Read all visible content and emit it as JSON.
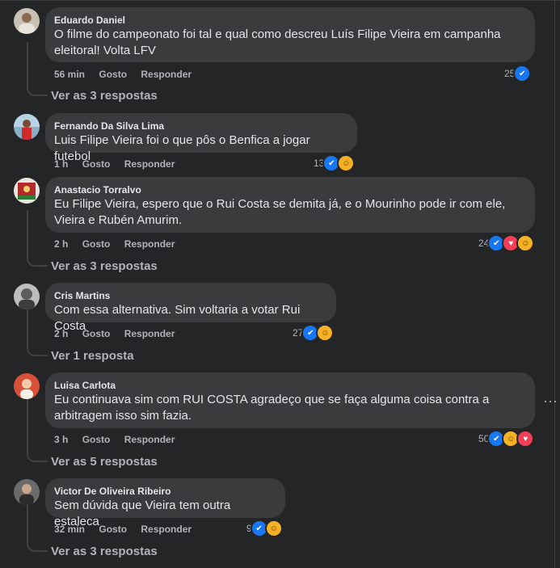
{
  "comments": [
    {
      "author": "Eduardo Daniel",
      "text_lines": [
        "O filme do campeonato foi tal e qual como descreu Luís Filipe Vieira em campanha",
        "eleitoral! Volta LFV"
      ],
      "time": "56 min",
      "like_label": "Gosto",
      "reply_label": "Responder",
      "reaction_count": "25",
      "reactions": [
        "like"
      ],
      "replies_link": "Ver as 3 respostas"
    },
    {
      "author": "Fernando Da Silva Lima",
      "text_lines": [
        "Luis Filipe Vieira foi o que pôs o Benfica a jogar futebol"
      ],
      "time": "1 h",
      "like_label": "Gosto",
      "reply_label": "Responder",
      "reaction_count": "13",
      "reactions": [
        "like",
        "haha"
      ],
      "replies_link": ""
    },
    {
      "author": "Anastacio Torralvo",
      "text_lines": [
        "Eu Filipe Vieira, espero que o Rui Costa se demita já, e o Mourinho pode ir com ele,",
        "Vieira e Rubén Amurim."
      ],
      "time": "2 h",
      "like_label": "Gosto",
      "reply_label": "Responder",
      "reaction_count": "24",
      "reactions": [
        "like",
        "love",
        "haha"
      ],
      "replies_link": "Ver as 3 respostas"
    },
    {
      "author": "Cris Martins",
      "text_lines": [
        "Com essa alternativa. Sim voltaria a votar Rui Costa"
      ],
      "time": "2 h",
      "like_label": "Gosto",
      "reply_label": "Responder",
      "reaction_count": "27",
      "reactions": [
        "like",
        "haha"
      ],
      "replies_link": "Ver 1 resposta"
    },
    {
      "author": "Luisa Carlota",
      "text_lines": [
        "Eu continuava sim com RUI COSTA agradeço que se faça alguma coisa contra a",
        "arbitragem isso sim fazia."
      ],
      "time": "3 h",
      "like_label": "Gosto",
      "reply_label": "Responder",
      "reaction_count": "50",
      "reactions": [
        "like",
        "haha",
        "love"
      ],
      "replies_link": "Ver as 5 respostas"
    },
    {
      "author": "Victor De Oliveira Ribeiro",
      "text_lines": [
        "Sem dúvida que Vieira tem outra estaleca"
      ],
      "time": "32 min",
      "like_label": "Gosto",
      "reply_label": "Responder",
      "reaction_count": "9",
      "reactions": [
        "like",
        "haha"
      ],
      "replies_link": "Ver as 3 respostas"
    }
  ],
  "more_options_glyph": "···",
  "colors": {
    "like": "#1877f2",
    "love": "#f33e58",
    "haha": "#f7b125",
    "bubble": "#3a3b3c",
    "background": "#242526"
  }
}
